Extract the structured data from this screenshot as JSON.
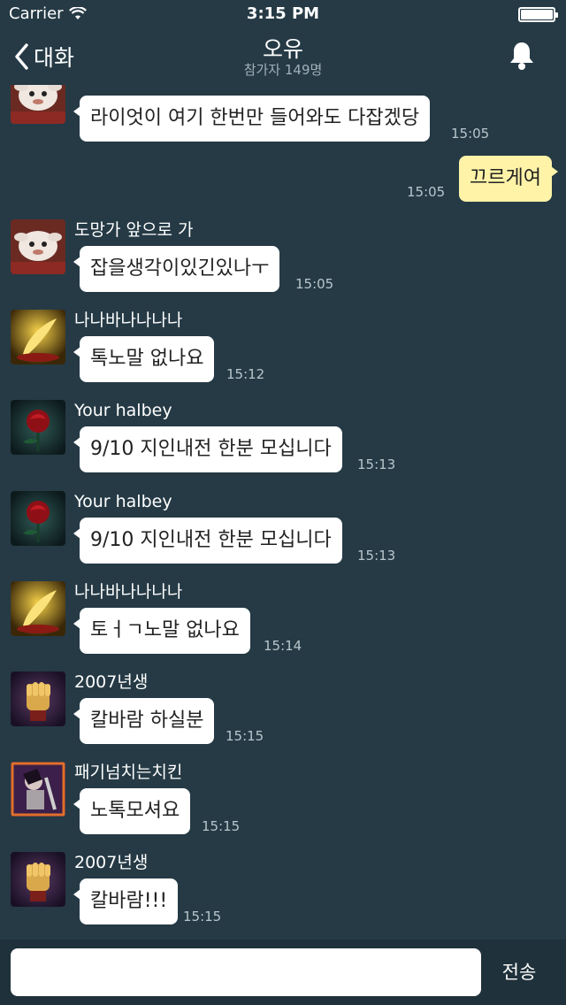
{
  "status_bar": {
    "carrier": "Carrier",
    "time": "3:15 PM"
  },
  "nav": {
    "back_label": "대화",
    "title": "오유",
    "subtitle": "참가자 149명"
  },
  "messages": [
    {
      "sender": "",
      "avatar": "poro-avatar",
      "text": "라이엇이 여기 한번만 들어와도 다잡겠당",
      "time": "15:05"
    },
    {
      "sender": "",
      "text": "끄르게여",
      "time": "15:05",
      "outgoing": true
    },
    {
      "sender": "도망가 앞으로 가",
      "avatar": "poro-avatar",
      "text": "잡을생각이있긴있나ㅜ",
      "time": "15:05"
    },
    {
      "sender": "나나바나나나나",
      "avatar": "gold-quill-avatar",
      "text": "톡노말 없나요",
      "time": "15:12"
    },
    {
      "sender": "Your halbey",
      "avatar": "rose-avatar",
      "text": "9/10 지인내전 한분 모십니다",
      "time": "15:13"
    },
    {
      "sender": "Your halbey",
      "avatar": "rose-avatar",
      "text": "9/10 지인내전 한분 모십니다",
      "time": "15:13"
    },
    {
      "sender": "나나바나나나나",
      "avatar": "gold-quill-avatar",
      "text": "토ㅓㄱ노말 없나요",
      "time": "15:14"
    },
    {
      "sender": "2007년생",
      "avatar": "gauntlet-avatar",
      "text": "칼바람 하실분",
      "time": "15:15"
    },
    {
      "sender": "패기넘치는치킨",
      "avatar": "warrior-avatar",
      "text": "노톡모셔요",
      "time": "15:15"
    },
    {
      "sender": "2007년생",
      "avatar": "gauntlet-avatar",
      "text": "칼바람!!!",
      "time": "15:15"
    }
  ],
  "composer": {
    "input_value": "",
    "send_label": "전송"
  },
  "colors": {
    "background": "#253a45",
    "bubble_in": "#ffffff",
    "bubble_out": "#fff3a8",
    "input_bar": "#1f313b"
  }
}
